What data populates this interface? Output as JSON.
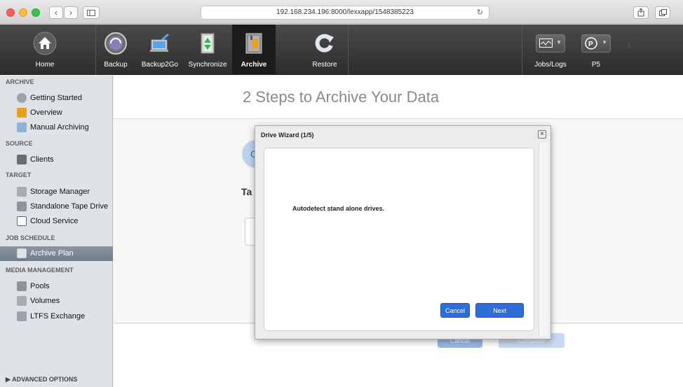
{
  "browser": {
    "url": "192.168.234.196:8000/lexxapp/1548385223",
    "back_glyph": "‹",
    "forward_glyph": "›"
  },
  "toolbar": {
    "items": [
      {
        "label": "Home",
        "icon": "home-icon"
      },
      {
        "label": "Backup",
        "icon": "backup-icon"
      },
      {
        "label": "Backup2Go",
        "icon": "backup2go-icon"
      },
      {
        "label": "Synchronize",
        "icon": "synchronize-icon"
      },
      {
        "label": "Archive",
        "icon": "archive-icon",
        "active": true
      },
      {
        "label": "Restore",
        "icon": "restore-icon"
      }
    ],
    "jobs_label": "Jobs/Logs",
    "p5_label": "P5"
  },
  "sidebar": {
    "sections": {
      "archive": "ARCHIVE",
      "source": "SOURCE",
      "target": "TARGET",
      "job_schedule": "JOB SCHEDULE",
      "media_management": "MEDIA MANAGEMENT"
    },
    "items": {
      "getting_started": "Getting Started",
      "overview": "Overview",
      "manual_archiving": "Manual Archiving",
      "clients": "Clients",
      "storage_manager": "Storage Manager",
      "standalone_tape_drive": "Standalone Tape Drive",
      "cloud_service": "Cloud Service",
      "archive_plan": "Archive Plan",
      "pools": "Pools",
      "volumes": "Volumes",
      "ltfs_exchange": "LTFS Exchange"
    },
    "advanced": "▶ ADVANCED OPTIONS"
  },
  "main": {
    "title": "2 Steps to Archive Your Data",
    "partial_heading": "Ta",
    "partial_step": "C",
    "cancel": "Cancel",
    "complete": "Complete"
  },
  "dialog": {
    "title": "Drive Wizard (1/5)",
    "close": "×",
    "message": "Autodetect stand alone drives.",
    "cancel": "Cancel",
    "next": "Next"
  },
  "colors": {
    "accent": "#2f6ed8",
    "toolbar_bg": "#2d2d2d",
    "sidebar_bg": "#dfe3e8",
    "selected_bg": "#7b8592"
  }
}
